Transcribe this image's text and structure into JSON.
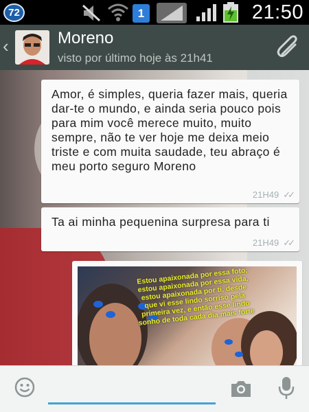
{
  "status_bar": {
    "notification_count": "72",
    "sim_number": "1",
    "time": "21:50"
  },
  "header": {
    "contact_name": "Moreno",
    "last_seen": "visto por último hoje às 21h41"
  },
  "messages": [
    {
      "text": "Amor,  é simples, queria fazer mais, queria dar-te o mundo, e ainda seria pouco pois para mim você merece muito, muito sempre,  não te ver hoje me deixa meio triste e com muita saudade, teu abraço é meu porto seguro Moreno",
      "time": "21H49"
    },
    {
      "text": "Ta ai minha pequenina surpresa para ti",
      "time": "21H49"
    }
  ],
  "photo_message": {
    "caption_overlay": "Estou apaixonada por essa foto, estou apaixonada por essa vida, estou apaixonada por ti, desde que vi esse lindo sorriso pela primeira vez, e então esse lindo sonho de toda cada dia mais forte"
  },
  "input": {
    "placeholder": "",
    "value": ""
  },
  "colors": {
    "header_bg": "#3e4a47",
    "bubble_bg": "#fafafa",
    "accent": "#3fa3d8"
  },
  "icons": [
    "notification-badge-icon",
    "mute-icon",
    "wifi-icon",
    "sim-icon",
    "signal-icon",
    "battery-charging-icon",
    "back-icon",
    "attach-icon",
    "emoji-icon",
    "camera-icon",
    "mic-icon",
    "double-check-icon"
  ]
}
